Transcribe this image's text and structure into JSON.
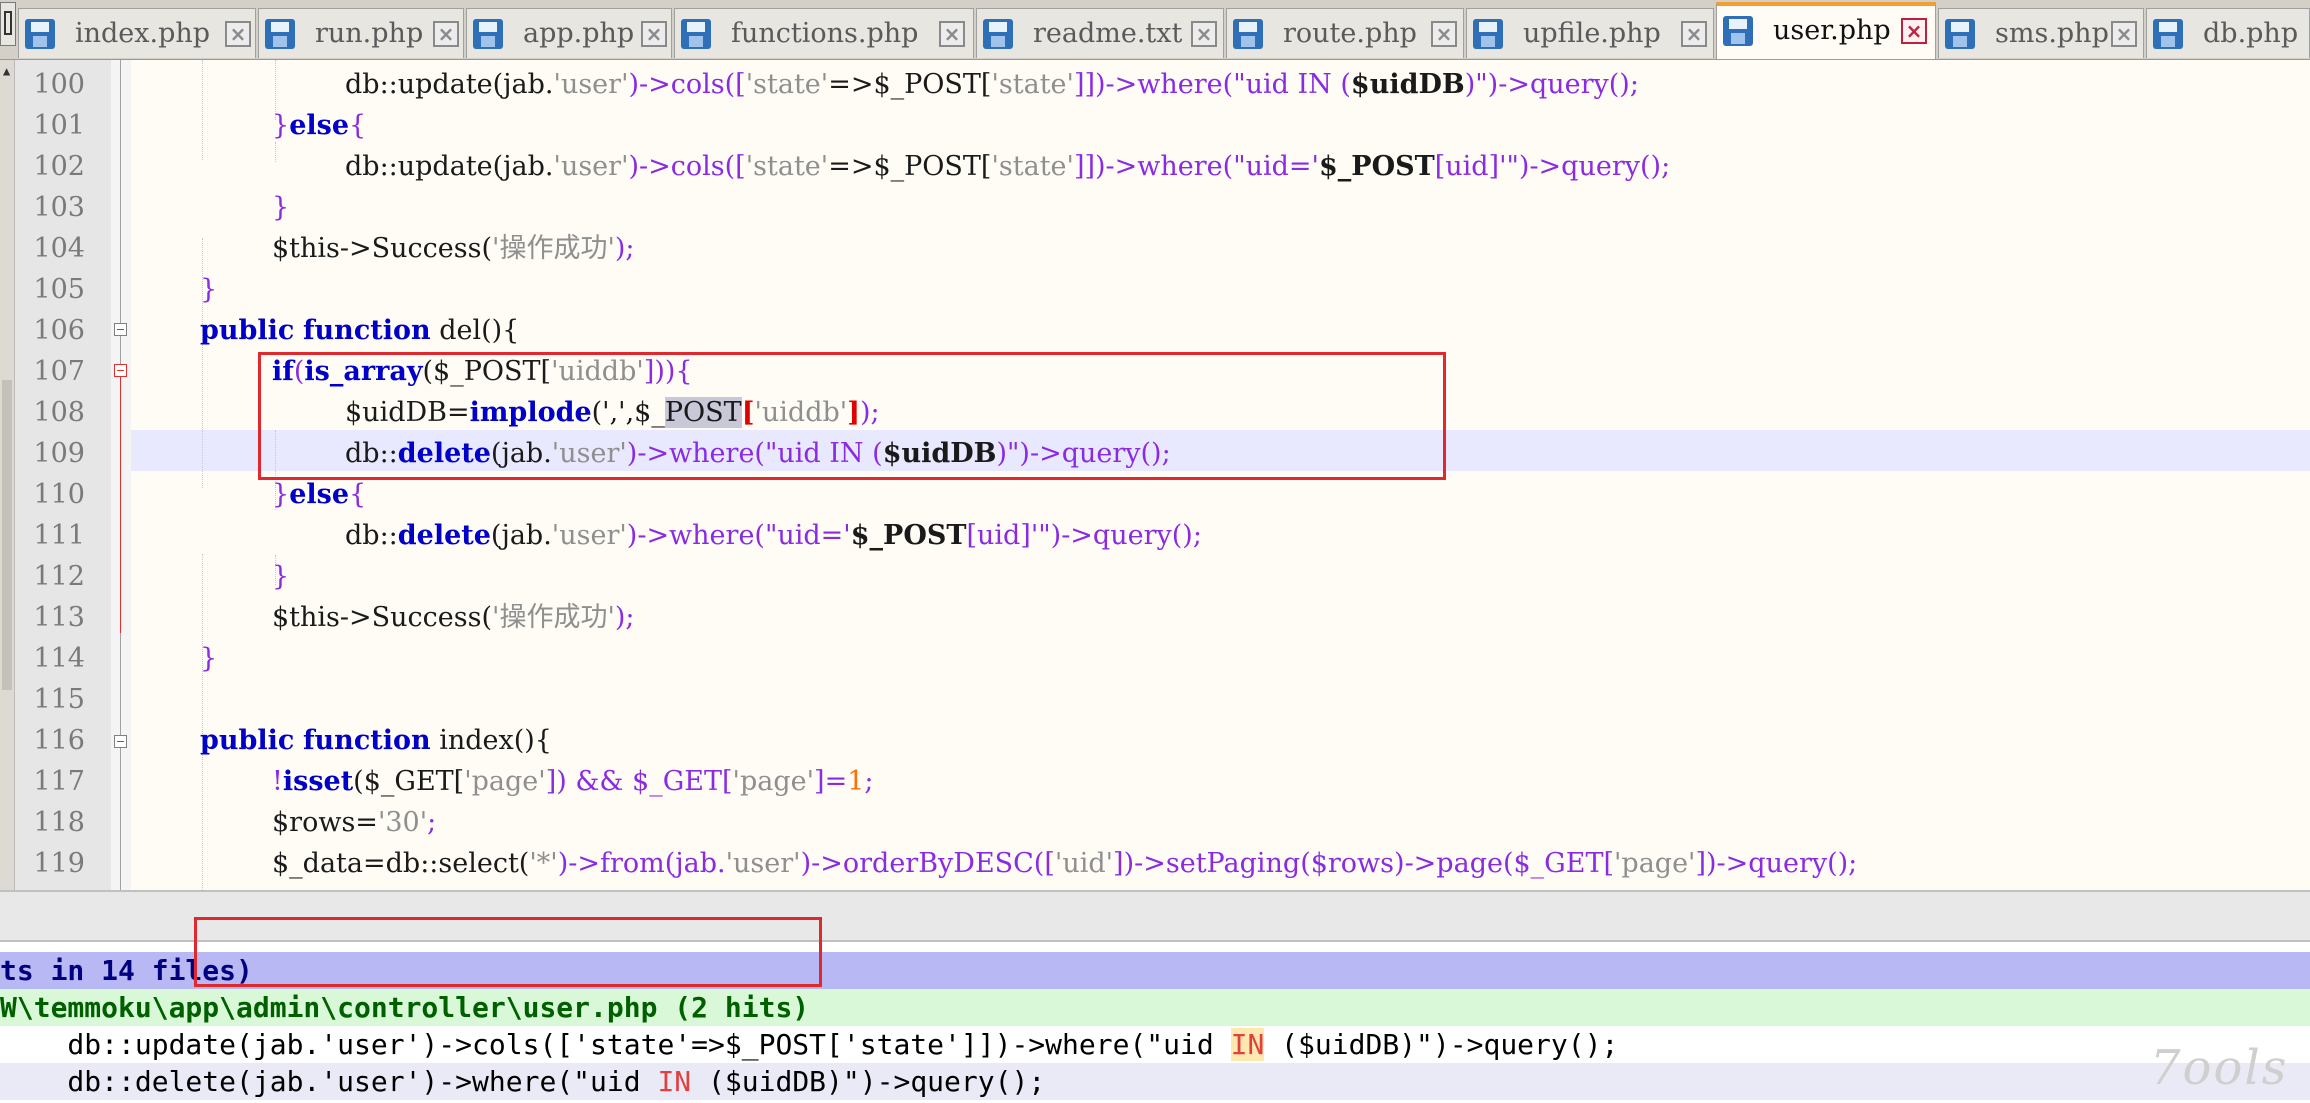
{
  "tabs": [
    {
      "name": "index.php",
      "active": false
    },
    {
      "name": "run.php",
      "active": false
    },
    {
      "name": "app.php",
      "active": false
    },
    {
      "name": "functions.php",
      "active": false
    },
    {
      "name": "readme.txt",
      "active": false
    },
    {
      "name": "route.php",
      "active": false
    },
    {
      "name": "upfile.php",
      "active": false
    },
    {
      "name": "user.php",
      "active": true
    },
    {
      "name": "sms.php",
      "active": false
    },
    {
      "name": "db.php",
      "active": false
    }
  ],
  "tab_close_glyph": "×",
  "editor": {
    "current_line": 108,
    "line_numbers": [
      "100",
      "101",
      "102",
      "103",
      "104",
      "105",
      "106",
      "107",
      "108",
      "109",
      "110",
      "111",
      "112",
      "113",
      "114",
      "115",
      "116",
      "117",
      "118",
      "119"
    ],
    "lines": {
      "l100": {
        "a": "db::update(jab.",
        "b": "'user'",
        "c": ")->cols([",
        "d": "'state'",
        "e": "=>$_POST[",
        "f": "'state'",
        "g": "]])->where(\"uid IN (",
        "h": "$uidDB",
        "i": ")\")->query();"
      },
      "l101": {
        "a": "}",
        "b": "else",
        "c": "{"
      },
      "l102": {
        "a": "db::update(jab.",
        "b": "'user'",
        "c": ")->cols([",
        "d": "'state'",
        "e": "=>$_POST[",
        "f": "'state'",
        "g": "]])->where(\"uid='",
        "h": "$_POST",
        "i": "[uid]'\")->query();"
      },
      "l103": {
        "a": "}"
      },
      "l104": {
        "a": "$this->Success(",
        "b": "'操作成功'",
        "c": ");"
      },
      "l105": {
        "a": "}"
      },
      "l106": {
        "a": "public",
        "b": "function",
        "c": "del(){"
      },
      "l107": {
        "a": "if",
        "b": "(",
        "c": "is_array",
        "d": "($_POST[",
        "e": "'uiddb'",
        "f": "])){"
      },
      "l108": {
        "a": "$uidDB=",
        "b": "implode",
        "c": "(',',$_",
        "d": "POST",
        "e": "[",
        "f": "'uiddb'",
        "g": "]",
        "h": ");"
      },
      "l109": {
        "a": "db::",
        "b": "delete",
        "c": "(jab.",
        "d": "'user'",
        "e": ")->where(\"uid IN (",
        "f": "$uidDB",
        "g": ")\")->query();"
      },
      "l110": {
        "a": "}",
        "b": "else",
        "c": "{"
      },
      "l111": {
        "a": "db::",
        "b": "delete",
        "c": "(jab.",
        "d": "'user'",
        "e": ")->where(\"uid='",
        "f": "$_POST",
        "g": "[uid]'\")->query();"
      },
      "l112": {
        "a": "}"
      },
      "l113": {
        "a": "$this->Success(",
        "b": "'操作成功'",
        "c": ");"
      },
      "l114": {
        "a": "}"
      },
      "l116": {
        "a": "public",
        "b": "function",
        "c": "index(){"
      },
      "l117": {
        "a": "!",
        "b": "isset",
        "c": "($_GET[",
        "d": "'page'",
        "e": "]) && $_GET[",
        "f": "'page'",
        "g": "]=",
        "h": "1",
        "i": ";"
      },
      "l118": {
        "a": "$rows=",
        "b": "'30'",
        "c": ";"
      },
      "l119": {
        "a": "$_data=db::select(",
        "b": "'*'",
        "c": ")->from(jab.",
        "d": "'user'",
        "e": ")->orderByDESC([",
        "f": "'uid'",
        "g": "])->setPaging($rows)->page($_GET[",
        "h": "'page'",
        "i": "])->query();"
      }
    }
  },
  "results": {
    "header": "ts in 14 files)",
    "file_line": "W\\temmoku\\app\\admin\\controller\\user.php (2 hits)",
    "hit1": {
      "pre": "    db::update(jab.'user')->cols(['state'=>$_POST['state']])->where(\"uid ",
      "kw": "IN",
      "post": " ($uidDB)\")->query();"
    },
    "hit2": {
      "pre": "    db::delete(jab.'user')->where(\"uid ",
      "kw": "IN",
      "post": " ($uidDB)\")->query();"
    }
  },
  "watermark": "7ools",
  "colors": {
    "highlight_box": "#e0282f",
    "current_line": "#e8e8ff",
    "active_tab_accent": "#f0a030"
  }
}
